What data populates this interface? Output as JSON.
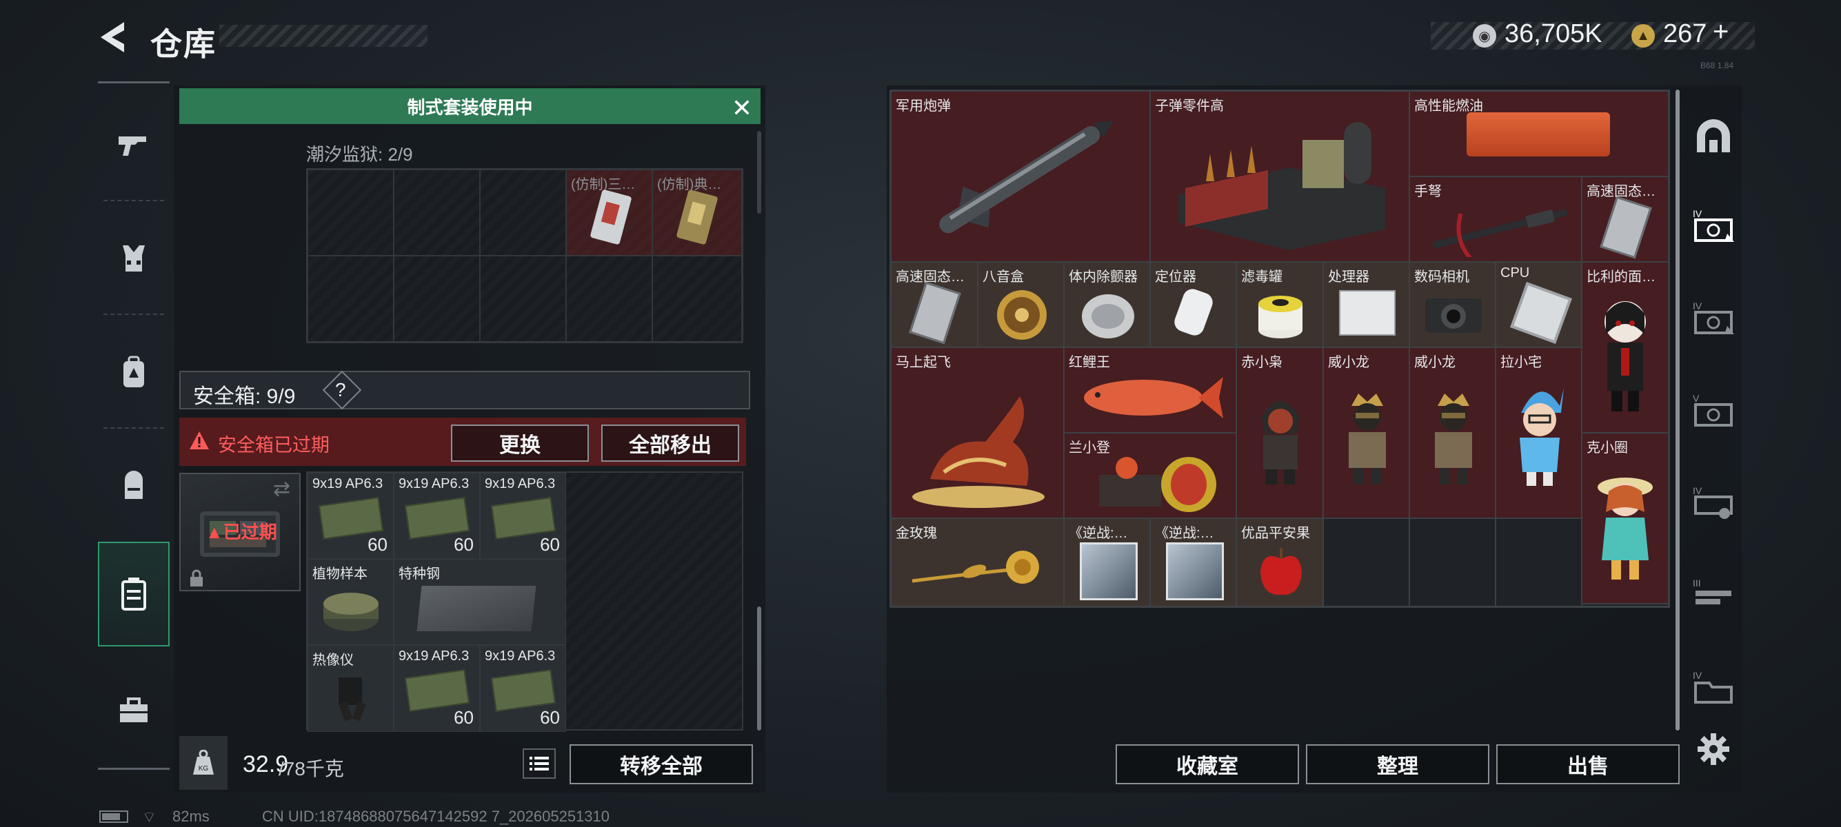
{
  "header": {
    "title": "仓库",
    "currency1_value": "36,705K",
    "currency2_value": "267",
    "currency2_plus": "+",
    "version": "B68 1.84"
  },
  "left_nav": {
    "items": [
      "weapons",
      "armor",
      "backpack",
      "rig",
      "safe-box",
      "toolbox"
    ],
    "active": "safe-box"
  },
  "loadout": {
    "banner": "制式套装使用中",
    "tide_label": "潮汐监狱: 2/9",
    "tide_items": [
      {
        "name": "(仿制)三…"
      },
      {
        "name": "(仿制)典…"
      }
    ]
  },
  "safe_box": {
    "label": "安全箱: 9/9",
    "help": "?",
    "expired_warning": "安全箱已过期",
    "replace_button": "更换",
    "move_all_out_button": "全部移出",
    "expired_tag": "已过期",
    "items": [
      {
        "name": "9x19 AP6.3",
        "count": "60"
      },
      {
        "name": "9x19 AP6.3",
        "count": "60"
      },
      {
        "name": "9x19 AP6.3",
        "count": "60"
      },
      {
        "name": "植物样本",
        "count": ""
      },
      {
        "name": "特种钢",
        "count": ""
      },
      {
        "name": "热像仪",
        "count": ""
      },
      {
        "name": "9x19 AP6.3",
        "count": "60"
      },
      {
        "name": "9x19 AP6.3",
        "count": "60"
      }
    ]
  },
  "capacity": {
    "current": "32.9",
    "max": "/78千克",
    "transfer_all_button": "转移全部"
  },
  "stash": {
    "items": [
      {
        "name": "军用炮弹"
      },
      {
        "name": "子弹零件高"
      },
      {
        "name": "高性能燃油"
      },
      {
        "name": "手弩"
      },
      {
        "name": "高速固态…"
      },
      {
        "name": "高速固态…"
      },
      {
        "name": "八音盒"
      },
      {
        "name": "体内除颤器"
      },
      {
        "name": "定位器"
      },
      {
        "name": "滤毒罐"
      },
      {
        "name": "处理器"
      },
      {
        "name": "数码相机"
      },
      {
        "name": "CPU"
      },
      {
        "name": "比利的面…"
      },
      {
        "name": "马上起飞"
      },
      {
        "name": "红鲤王"
      },
      {
        "name": "赤小枭"
      },
      {
        "name": "威小龙"
      },
      {
        "name": "威小龙"
      },
      {
        "name": "拉小宅"
      },
      {
        "name": "兰小登"
      },
      {
        "name": "克小圈"
      },
      {
        "name": "金玫瑰"
      },
      {
        "name": "《逆战:…"
      },
      {
        "name": "《逆战:…"
      },
      {
        "name": "优品平安果"
      }
    ],
    "collection_button": "收藏室",
    "organize_button": "整理",
    "sell_button": "出售"
  },
  "right_nav": {
    "tiers": [
      "IV",
      "IV",
      "V",
      "IV",
      "III",
      "IV"
    ]
  },
  "footer": {
    "ping": "82ms",
    "uid": "CN UID:18748688075647142592 7_202605251310"
  }
}
